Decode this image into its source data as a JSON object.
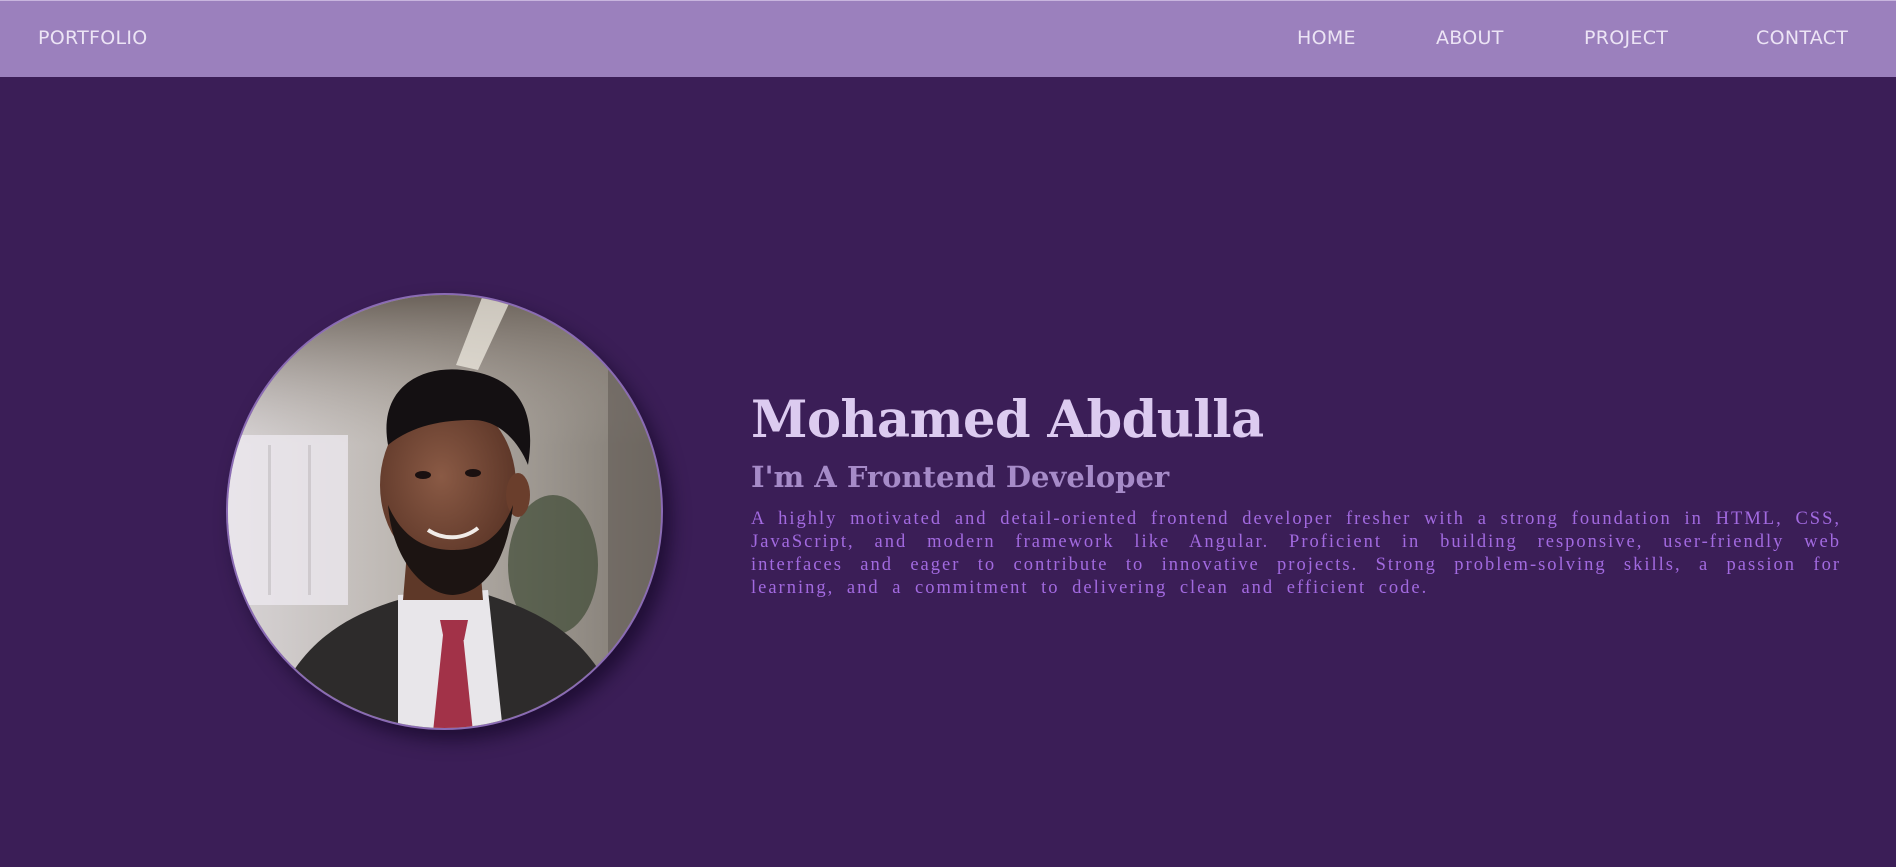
{
  "nav": {
    "brand": "PORTFOLIO",
    "links": [
      "HOME",
      "ABOUT",
      "PROJECT",
      "CONTACT"
    ]
  },
  "hero": {
    "name": "Mohamed Abdulla",
    "role": "I'm A Frontend Developer",
    "description": "A highly motivated and detail-oriented frontend developer fresher with a strong foundation in HTML, CSS, JavaScript, and modern framework like Angular. Proficient in building responsive, user-friendly web interfaces and eager to contribute to innovative projects. Strong problem-solving skills, a passion for learning, and a commitment to delivering clean and efficient code.",
    "avatar_alt": "profile-photo"
  },
  "colors": {
    "background": "#3b1e57",
    "navbar": "#9b80bd",
    "nav_text": "#ece4f5",
    "name": "#dccbf0",
    "role": "#a68bc8",
    "description": "#a26ae0"
  }
}
